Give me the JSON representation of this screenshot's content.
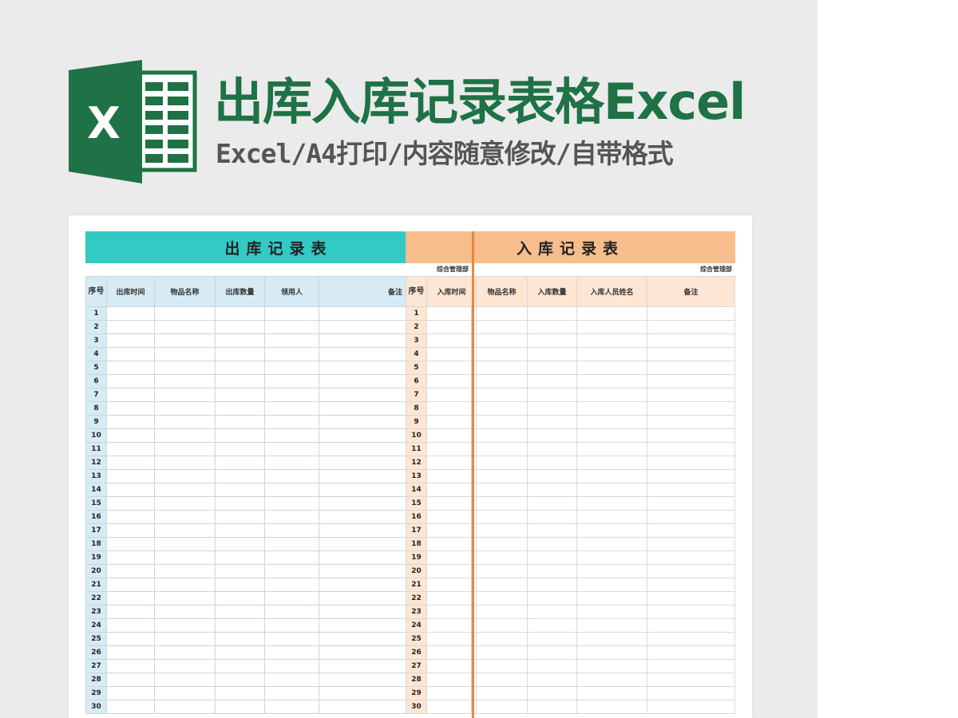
{
  "header": {
    "title": "出库入库记录表格Excel",
    "subtitle": "Excel/A4打印/内容随意修改/自带格式",
    "logo_letter": "X",
    "logo_icon": "excel-logo-icon"
  },
  "colors": {
    "brand_green": "#1f7245",
    "out_title_bg": "#33c9c5",
    "out_header_bg": "#d6ebf3",
    "in_title_bg": "#f7bd8d",
    "in_header_bg": "#fde6d3",
    "divider": "#e8893a"
  },
  "outbound": {
    "title": "出库记录表",
    "dept": "综合管理部",
    "seq_header": "序号",
    "columns": [
      "出库时间",
      "物品名称",
      "出库数量",
      "领用人",
      "备注"
    ],
    "rows": [
      "1",
      "2",
      "3",
      "4",
      "5",
      "6",
      "7",
      "8",
      "9",
      "10",
      "11",
      "12",
      "13",
      "14",
      "15",
      "16",
      "17",
      "18",
      "19",
      "20",
      "21",
      "22",
      "23",
      "24",
      "25",
      "26",
      "27",
      "28",
      "29",
      "30"
    ]
  },
  "inbound": {
    "title": "入库记录表",
    "dept": "综合管理部",
    "seq_header": "序号",
    "columns": [
      "入库时间",
      "物品名称",
      "入库数量",
      "入库人员姓名",
      "备注"
    ],
    "rows": [
      "1",
      "2",
      "3",
      "4",
      "5",
      "6",
      "7",
      "8",
      "9",
      "10",
      "11",
      "12",
      "13",
      "14",
      "15",
      "16",
      "17",
      "18",
      "19",
      "20",
      "21",
      "22",
      "23",
      "24",
      "25",
      "26",
      "27",
      "28",
      "29",
      "30"
    ]
  }
}
